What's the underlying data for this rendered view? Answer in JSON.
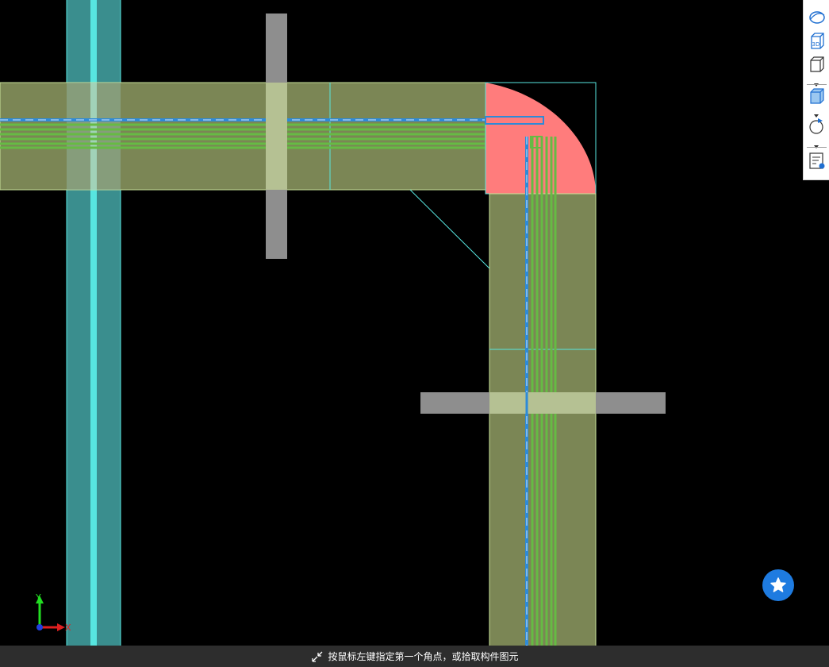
{
  "status_bar": {
    "prompt_text": "按鼠标左键指定第一个角点，或拾取构件图元",
    "icon": "crosshair-corner-icon"
  },
  "axis_indicator": {
    "y_label": "Y",
    "x_label": "X"
  },
  "view_toolbar": {
    "buttons": [
      {
        "name": "orbit-view-button",
        "icon": "orbit-icon"
      },
      {
        "name": "3d-view-button",
        "icon": "cube-3d-icon",
        "badge": "3D"
      },
      {
        "name": "view-direction-button",
        "icon": "cube-outline-icon"
      },
      {
        "name": "display-mode-button",
        "icon": "cube-shaded-icon"
      },
      {
        "name": "rotate-button",
        "icon": "rotate-icon"
      },
      {
        "name": "properties-view-button",
        "icon": "document-view-icon"
      }
    ]
  },
  "floating_button": {
    "icon": "star-icon"
  },
  "colors": {
    "background": "#000000",
    "column_teal": "#3a8e8e",
    "column_cyan_line": "#57e6e0",
    "beam_olive": "#7b8655",
    "beam_outline": "#c9e39a",
    "rebar_green": "#66bb44",
    "corner_fill": "#ff7c7c",
    "gray_member": "#8e8e8e",
    "dash_blue": "#2d8ad8",
    "accent_blue": "#1e7be0"
  }
}
